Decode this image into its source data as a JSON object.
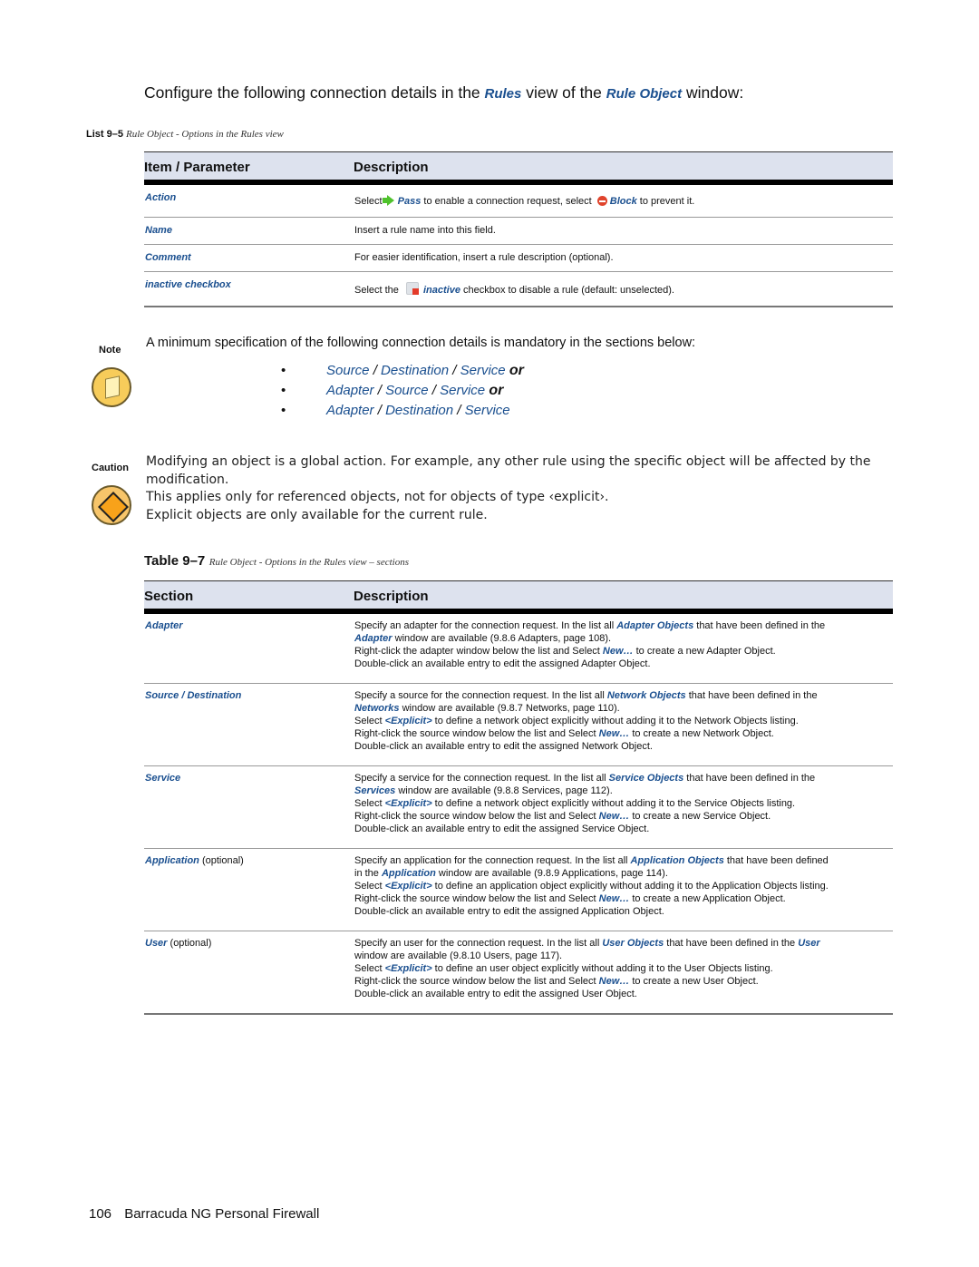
{
  "intro": {
    "prefix": "Configure the following connection details in the ",
    "link1": "Rules",
    "middle": " view of the ",
    "link2": "Rule Object",
    "suffix": " window:"
  },
  "list_caption": {
    "number": "List 9–5",
    "title": "Rule Object - Options in the Rules view"
  },
  "table1": {
    "headers": [
      "Item / Parameter",
      "Description"
    ],
    "rows": [
      {
        "param": "Action",
        "desc": {
          "t1": "Select ",
          "icon1": "pass-arrow-icon",
          "l1": "Pass",
          "t2": " to enable a connection request, select ",
          "icon2": "block-icon",
          "l2": "Block",
          "t3": " to prevent it."
        }
      },
      {
        "param": "Name",
        "desc": "Insert a rule name into this field."
      },
      {
        "param": "Comment",
        "desc": "For easier identification, insert a rule description (optional)."
      },
      {
        "param": "inactive checkbox",
        "desc": {
          "t1": "Select the ",
          "icon": "inactive-icon",
          "l1": "inactive",
          "t2": " checkbox to disable a rule (default: unselected)."
        }
      }
    ]
  },
  "note": {
    "label": "Note",
    "text": "A minimum specification of the following connection details is mandatory in the sections below:",
    "bullets": [
      {
        "items": [
          "Source",
          "Destination",
          "Service"
        ],
        "suffix": "or"
      },
      {
        "items": [
          "Adapter",
          "Source",
          "Service"
        ],
        "suffix": "or"
      },
      {
        "items": [
          "Adapter",
          "Destination",
          "Service"
        ],
        "suffix": ""
      }
    ],
    "separator": " / "
  },
  "caution": {
    "label": "Caution",
    "lines": [
      "Modifying an object is a global action. For example, any other rule using the specific object will be affected by the modification.",
      "This applies only for referenced objects, not for objects of type ‹explicit›.",
      "Explicit objects are only available for the current rule."
    ]
  },
  "table_caption": {
    "number": "Table 9–7",
    "title": "Rule Object - Options in the Rules view – sections"
  },
  "table2": {
    "headers": [
      "Section",
      "Description"
    ],
    "rows": [
      {
        "section": "Adapter",
        "optional": "",
        "lines": [
          [
            "Specify an adapter for the connection request. In the list all ",
            {
              "l": "Adapter Objects"
            },
            " that have been defined in the"
          ],
          [
            {
              "l": "Adapter"
            },
            " window are available (9.8.6 Adapters, page 108)."
          ],
          [
            "Right-click the adapter window below the list and Select ",
            {
              "l": "New…"
            },
            " to create a new Adapter Object."
          ],
          [
            "Double-click an available entry to edit the assigned Adapter Object."
          ]
        ]
      },
      {
        "section": "Source / Destination",
        "optional": "",
        "lines": [
          [
            "Specify a source for the connection request. In the list all ",
            {
              "l": "Network Objects"
            },
            " that have been defined in the"
          ],
          [
            {
              "l": "Networks"
            },
            " window are available (9.8.7 Networks, page 110)."
          ],
          [
            "Select ",
            {
              "l": "<Explicit>"
            },
            " to define a network object explicitly without adding it to the Network Objects listing."
          ],
          [
            "Right-click the source window below the list and Select ",
            {
              "l": "New…"
            },
            " to create a new Network Object."
          ],
          [
            "Double-click an available entry to edit the assigned Network Object."
          ]
        ]
      },
      {
        "section": "Service",
        "optional": "",
        "lines": [
          [
            "Specify a service for the connection request. In the list all ",
            {
              "l": "Service Objects"
            },
            " that have been defined in the"
          ],
          [
            {
              "l": "Services"
            },
            " window are available (9.8.8 Services, page 112)."
          ],
          [
            "Select ",
            {
              "l": "<Explicit>"
            },
            " to define a network object explicitly without adding it to the Service Objects listing."
          ],
          [
            "Right-click the source window below the list and Select ",
            {
              "l": "New…"
            },
            " to create a new Service Object."
          ],
          [
            "Double-click an available entry to edit the assigned Service Object."
          ]
        ]
      },
      {
        "section": "Application",
        "optional": " (optional)",
        "lines": [
          [
            "Specify an application for the connection request. In the list all ",
            {
              "l": "Application Objects"
            },
            " that have been defined"
          ],
          [
            "in the ",
            {
              "l": "Application"
            },
            " window are available (9.8.9 Applications, page 114)."
          ],
          [
            "Select ",
            {
              "l": "<Explicit>"
            },
            " to define an application object explicitly without adding it to the Application Objects listing."
          ],
          [
            "Right-click the source window below the list and Select ",
            {
              "l": "New…"
            },
            " to create a new Application Object."
          ],
          [
            "Double-click an available entry to edit the assigned Application Object."
          ]
        ]
      },
      {
        "section": "User",
        "optional": " (optional)",
        "lines": [
          [
            "Specify an user for the connection request. In the list all ",
            {
              "l": "User Objects"
            },
            " that have been defined in the ",
            {
              "l": "User"
            }
          ],
          [
            "window are available (9.8.10 Users, page 117)."
          ],
          [
            "Select ",
            {
              "l": "<Explicit>"
            },
            " to define an user object explicitly without adding it to the User Objects listing."
          ],
          [
            "Right-click the source window below the list and Select ",
            {
              "l": "New…"
            },
            " to create a new User Object."
          ],
          [
            "Double-click an available entry to edit the assigned User Object."
          ]
        ]
      }
    ]
  },
  "footer": {
    "page": "106",
    "title": "Barracuda NG Personal Firewall"
  },
  "colors": {
    "link": "#1a4f8f",
    "header_bg": "#dde2ee",
    "pass": "#4fc22c",
    "block": "#e0442c",
    "note_icon": "#f7cc5a",
    "caution_icon": "#f8a21a"
  }
}
